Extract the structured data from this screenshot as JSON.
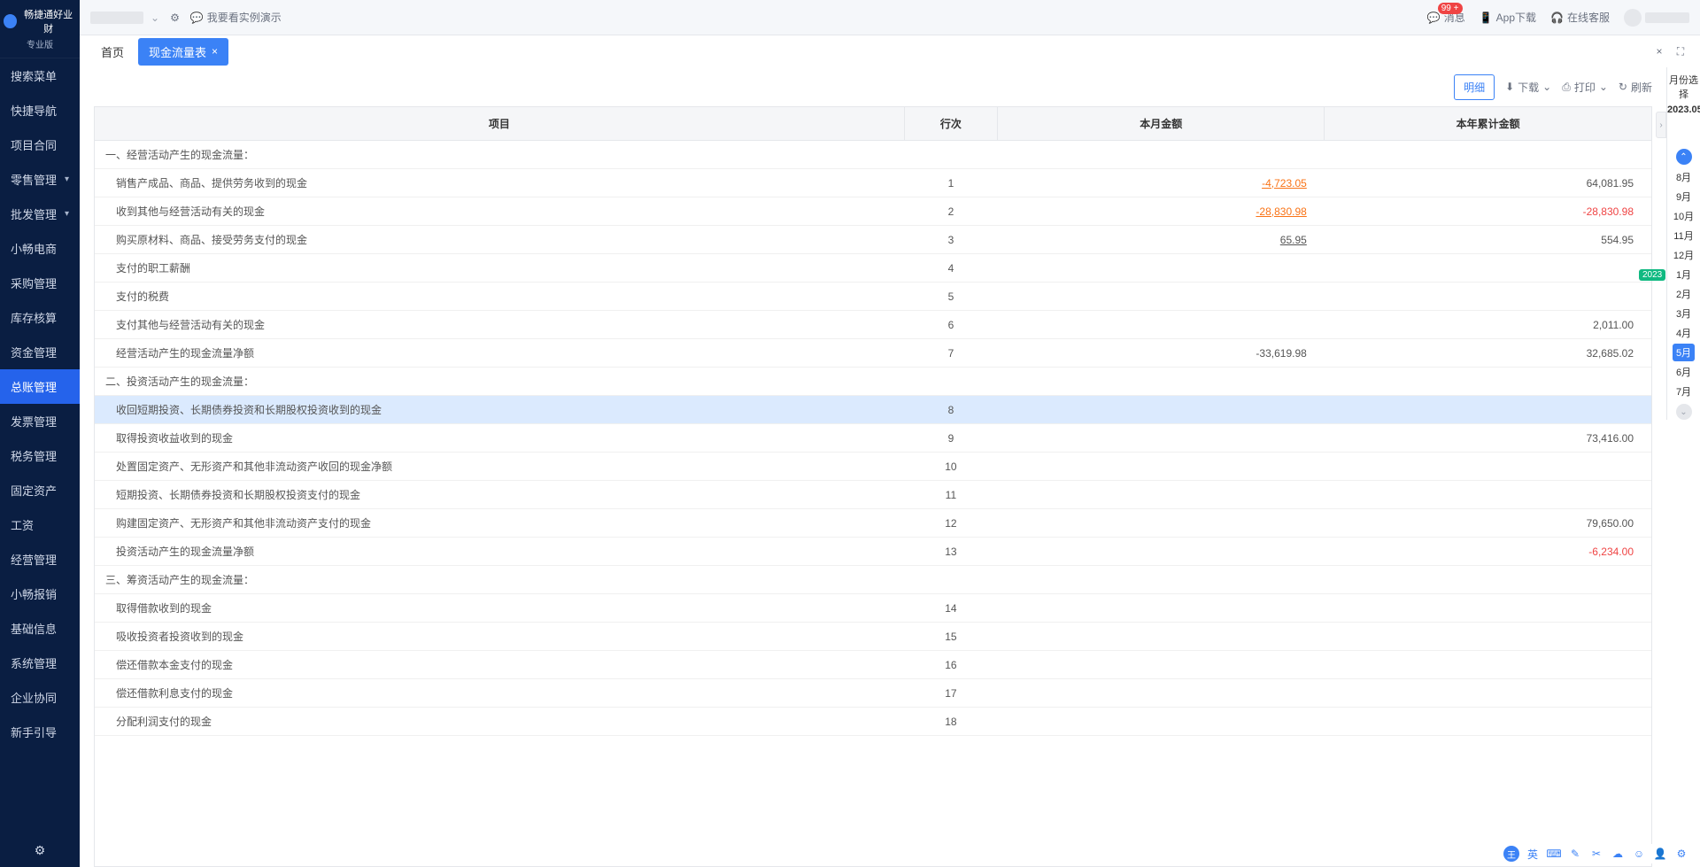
{
  "app_name": "畅捷通好业财",
  "app_edition": "专业版",
  "sidebar": {
    "items": [
      {
        "label": "搜索菜单",
        "arrow": false
      },
      {
        "label": "快捷导航",
        "arrow": false
      },
      {
        "label": "项目合同",
        "arrow": false
      },
      {
        "label": "零售管理",
        "arrow": true
      },
      {
        "label": "批发管理",
        "arrow": true
      },
      {
        "label": "小畅电商",
        "arrow": false
      },
      {
        "label": "采购管理",
        "arrow": false
      },
      {
        "label": "库存核算",
        "arrow": false
      },
      {
        "label": "资金管理",
        "arrow": false
      },
      {
        "label": "总账管理",
        "arrow": false,
        "active": true
      },
      {
        "label": "发票管理",
        "arrow": false
      },
      {
        "label": "税务管理",
        "arrow": false
      },
      {
        "label": "固定资产",
        "arrow": false
      },
      {
        "label": "工资",
        "arrow": false
      },
      {
        "label": "经营管理",
        "arrow": false
      },
      {
        "label": "小畅报销",
        "arrow": false
      },
      {
        "label": "基础信息",
        "arrow": false
      },
      {
        "label": "系统管理",
        "arrow": false
      },
      {
        "label": "企业协同",
        "arrow": false
      },
      {
        "label": "新手引导",
        "arrow": false
      }
    ]
  },
  "topbar": {
    "demo_link": "我要看实例演示",
    "actions": {
      "messages": "消息",
      "badge": "99 +",
      "download": "App下载",
      "support": "在线客服"
    }
  },
  "tabs": {
    "home": "首页",
    "active": "现金流量表"
  },
  "toolbar": {
    "detail": "明细",
    "download": "下载",
    "print": "打印",
    "refresh": "刷新"
  },
  "table": {
    "headers": {
      "item": "项目",
      "rownum": "行次",
      "month_amount": "本月金额",
      "ytd_amount": "本年累计金额"
    },
    "rows": [
      {
        "item": "一、经营活动产生的现金流量：",
        "rownum": "",
        "month": "",
        "ytd": "",
        "section": true
      },
      {
        "item": "销售产成品、商品、提供劳务收到的现金",
        "rownum": "1",
        "month": "-4,723.05",
        "ytd": "64,081.95",
        "indent": true,
        "link": true,
        "neg": true
      },
      {
        "item": "收到其他与经营活动有关的现金",
        "rownum": "2",
        "month": "-28,830.98",
        "ytd": "-28,830.98",
        "indent": true,
        "link": true,
        "neg": true,
        "neg_ytd": true
      },
      {
        "item": "购买原材料、商品、接受劳务支付的现金",
        "rownum": "3",
        "month": "65.95",
        "ytd": "554.95",
        "indent": true,
        "link_plain": true
      },
      {
        "item": "支付的职工薪酬",
        "rownum": "4",
        "month": "",
        "ytd": "",
        "indent": true
      },
      {
        "item": "支付的税费",
        "rownum": "5",
        "month": "",
        "ytd": "",
        "indent": true
      },
      {
        "item": "支付其他与经营活动有关的现金",
        "rownum": "6",
        "month": "",
        "ytd": "2,011.00",
        "indent": true
      },
      {
        "item": "经营活动产生的现金流量净额",
        "rownum": "7",
        "month": "-33,619.98",
        "ytd": "32,685.02",
        "indent": true
      },
      {
        "item": "二、投资活动产生的现金流量：",
        "rownum": "",
        "month": "",
        "ytd": "",
        "section": true
      },
      {
        "item": "收回短期投资、长期债券投资和长期股权投资收到的现金",
        "rownum": "8",
        "month": "",
        "ytd": "",
        "indent": true,
        "highlight": true
      },
      {
        "item": "取得投资收益收到的现金",
        "rownum": "9",
        "month": "",
        "ytd": "73,416.00",
        "indent": true
      },
      {
        "item": "处置固定资产、无形资产和其他非流动资产收回的现金净额",
        "rownum": "10",
        "month": "",
        "ytd": "",
        "indent": true
      },
      {
        "item": "短期投资、长期债券投资和长期股权投资支付的现金",
        "rownum": "11",
        "month": "",
        "ytd": "",
        "indent": true
      },
      {
        "item": "购建固定资产、无形资产和其他非流动资产支付的现金",
        "rownum": "12",
        "month": "",
        "ytd": "79,650.00",
        "indent": true
      },
      {
        "item": "投资活动产生的现金流量净额",
        "rownum": "13",
        "month": "",
        "ytd": "-6,234.00",
        "indent": true,
        "neg_ytd": true
      },
      {
        "item": "三、筹资活动产生的现金流量：",
        "rownum": "",
        "month": "",
        "ytd": "",
        "section": true
      },
      {
        "item": "取得借款收到的现金",
        "rownum": "14",
        "month": "",
        "ytd": "",
        "indent": true
      },
      {
        "item": "吸收投资者投资收到的现金",
        "rownum": "15",
        "month": "",
        "ytd": "",
        "indent": true
      },
      {
        "item": "偿还借款本金支付的现金",
        "rownum": "16",
        "month": "",
        "ytd": "",
        "indent": true
      },
      {
        "item": "偿还借款利息支付的现金",
        "rownum": "17",
        "month": "",
        "ytd": "",
        "indent": true
      },
      {
        "item": "分配利润支付的现金",
        "rownum": "18",
        "month": "",
        "ytd": "",
        "indent": true
      }
    ]
  },
  "month_panel": {
    "title": "月份选择",
    "selected": "2023.05",
    "year_tag": "2023",
    "months": [
      "8月",
      "9月",
      "10月",
      "11月",
      "12月",
      "1月",
      "2月",
      "3月",
      "4月",
      "5月",
      "6月",
      "7月"
    ],
    "active": "5月"
  },
  "ime": {
    "wang": "王",
    "lang": "英"
  }
}
